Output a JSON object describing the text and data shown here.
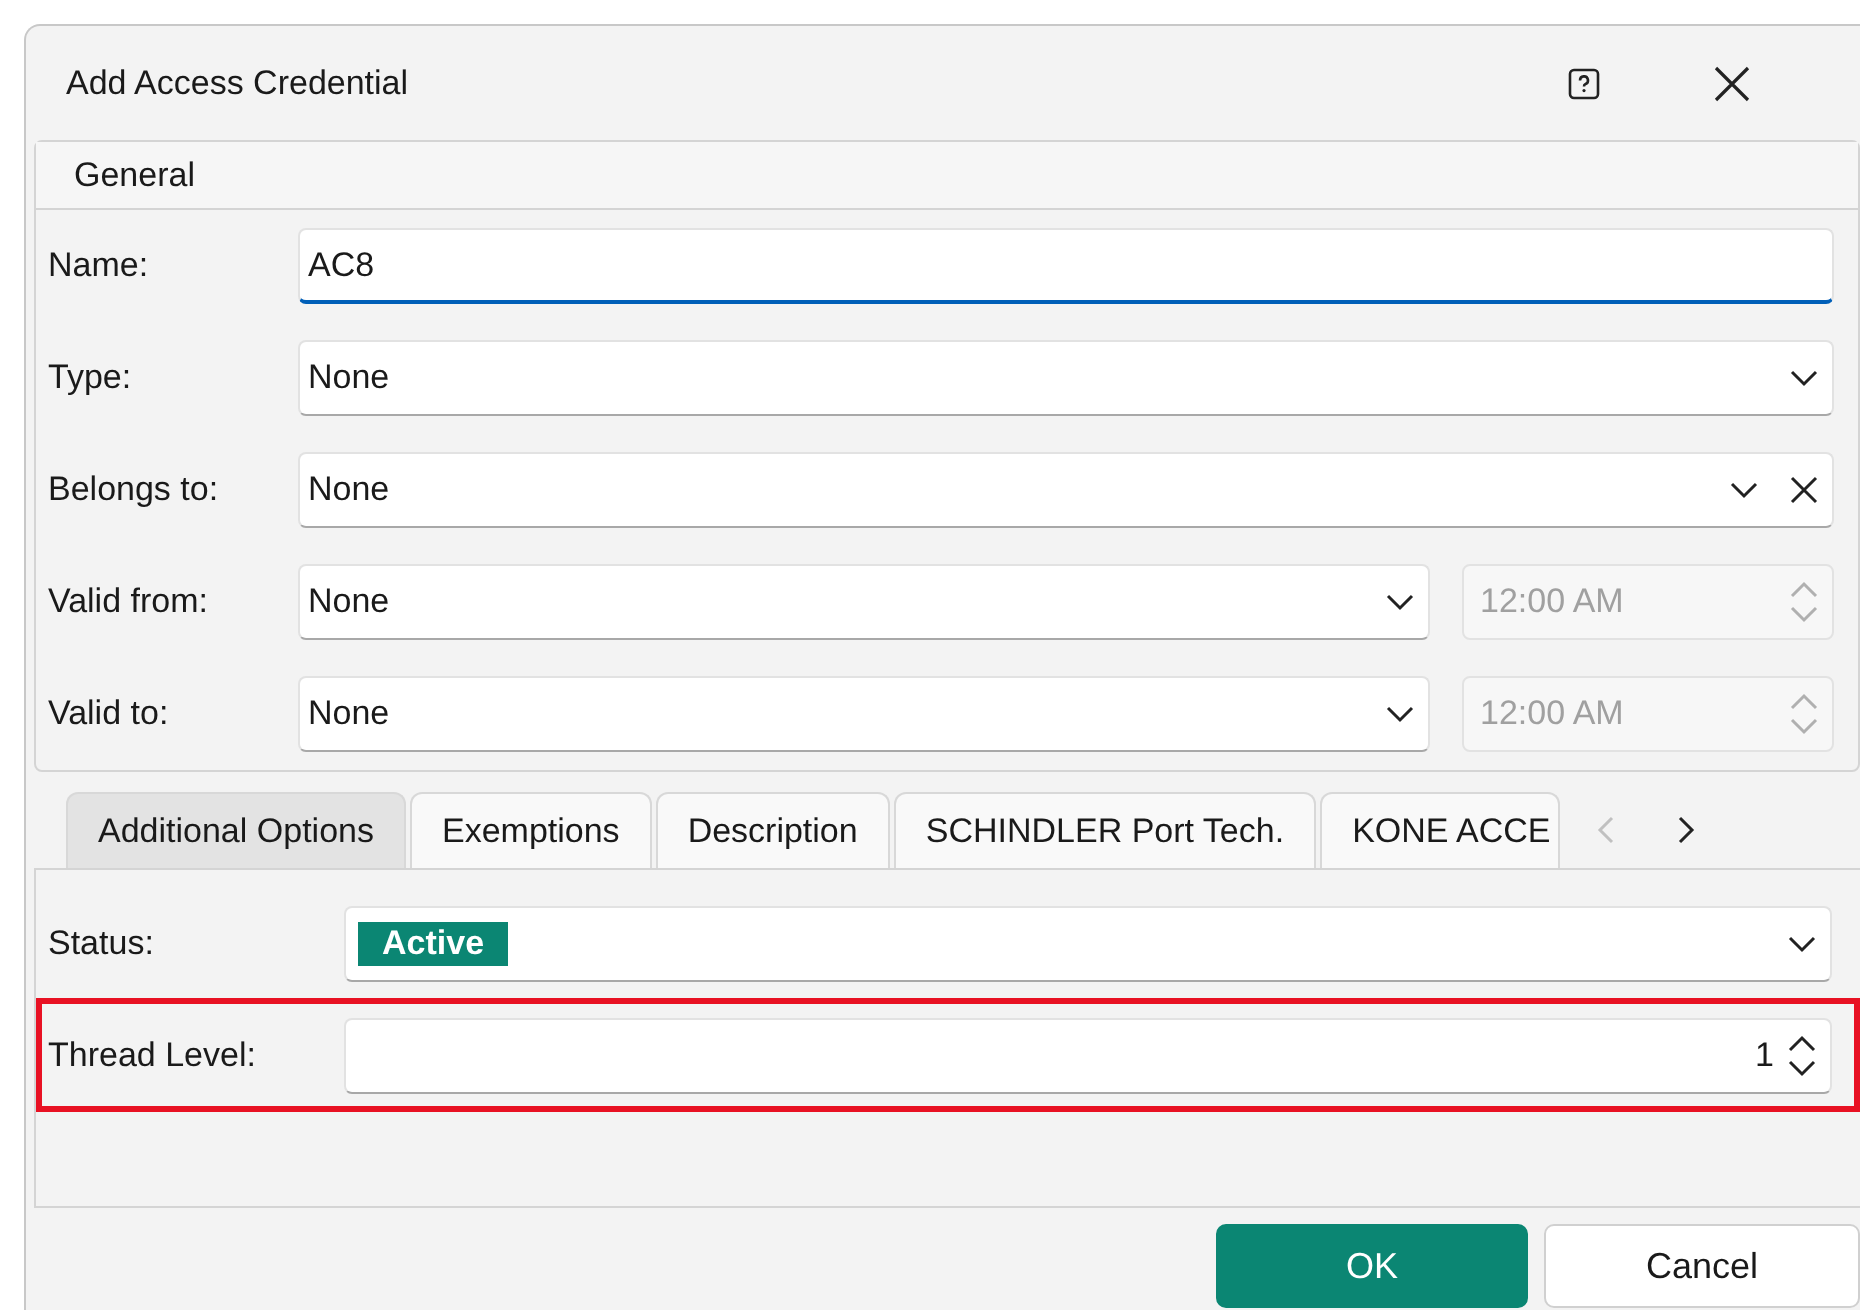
{
  "window": {
    "title": "Add Access Credential"
  },
  "section": {
    "title": "General"
  },
  "fields": [
    {
      "label": "Name:",
      "kind": "text",
      "value": "AC8",
      "focused": true
    },
    {
      "label": "Type:",
      "kind": "dropdown",
      "value": "None",
      "focused": false
    },
    {
      "label": "Belongs to:",
      "kind": "clearable",
      "value": "None",
      "focused": false
    },
    {
      "label": "Valid from:",
      "kind": "datetime",
      "value": "None",
      "time": "12:00 AM",
      "time_disabled": true,
      "focused": false
    },
    {
      "label": "Valid to:",
      "kind": "datetime",
      "value": "None",
      "time": "12:00 AM",
      "time_disabled": true,
      "focused": false
    }
  ],
  "tabs": [
    {
      "label": "Additional Options",
      "selected": true
    },
    {
      "label": "Exemptions",
      "selected": false
    },
    {
      "label": "Description",
      "selected": false
    },
    {
      "label": "SCHINDLER Port Tech.",
      "selected": false
    },
    {
      "label": "KONE ACCE",
      "selected": false
    }
  ],
  "options": [
    {
      "label": "Status:",
      "kind": "status",
      "value": "Active",
      "color": "#0b8673",
      "highlighted": false
    },
    {
      "label": "Thread Level:",
      "kind": "spin",
      "value": "1",
      "highlighted": true
    }
  ],
  "buttons": [
    {
      "label": "OK",
      "primary": true
    },
    {
      "label": "Cancel",
      "primary": false
    }
  ]
}
